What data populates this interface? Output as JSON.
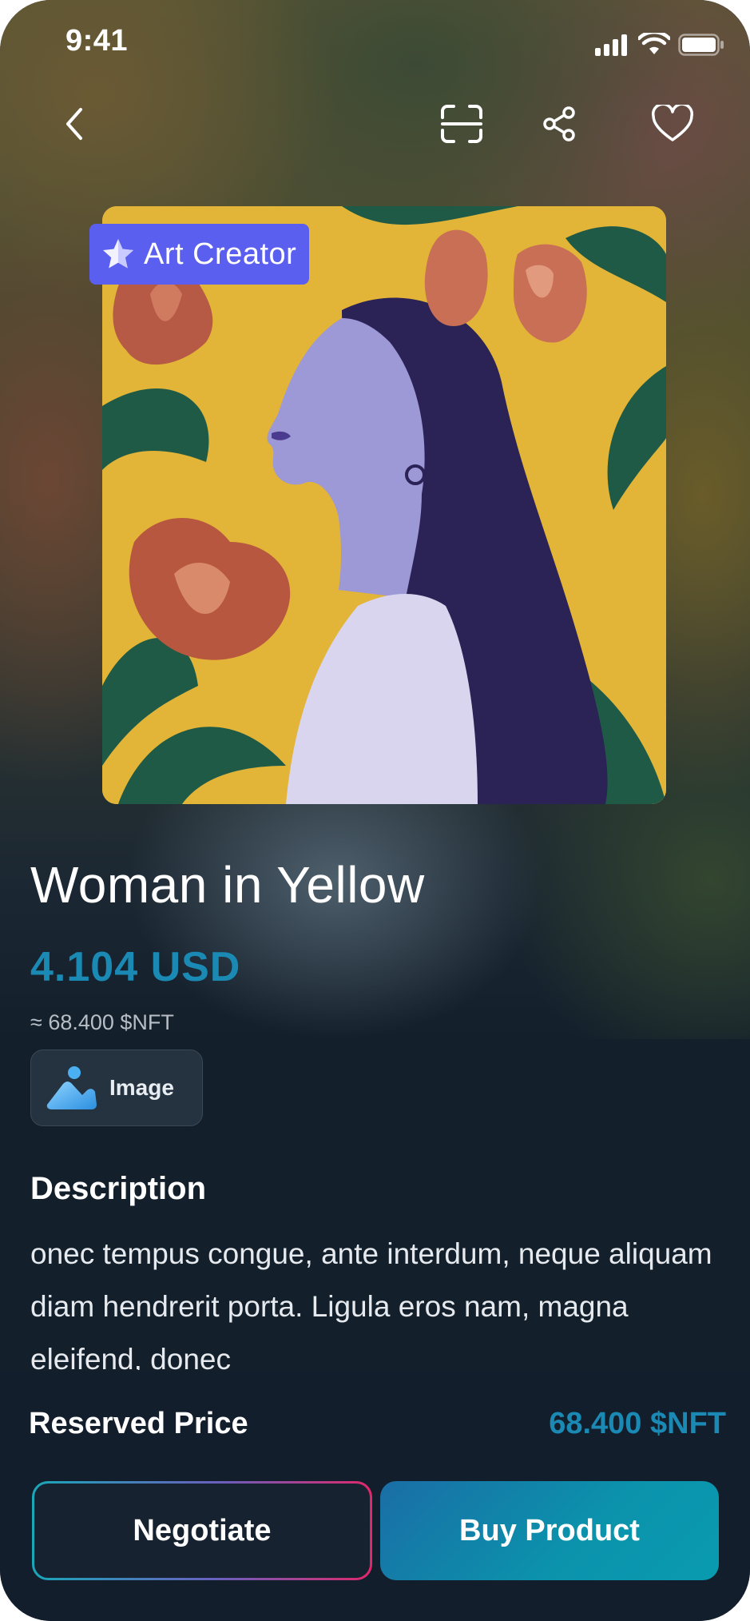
{
  "status_bar": {
    "time": "9:41"
  },
  "header": {
    "icons": [
      "back-chevron-icon",
      "scan-icon",
      "share-icon",
      "heart-icon"
    ]
  },
  "badge": {
    "label": "Art Creator",
    "icon": "star-icon",
    "color": "#5b5ff0"
  },
  "product": {
    "title": "Woman in Yellow",
    "price": "4.104 USD",
    "price_nft": "≈ 68.400 $NFT",
    "type_label": "Image",
    "type_icon": "image-icon"
  },
  "description": {
    "heading": "Description",
    "text": "onec tempus congue, ante interdum, neque aliquam diam hendrerit porta. Ligula eros nam, magna eleifend, donec"
  },
  "footer": {
    "reserved_label": "Reserved Price",
    "reserved_value": "68.400 $NFT",
    "negotiate_label": "Negotiate",
    "buy_label": "Buy Product"
  },
  "colors": {
    "accent_price": "#1a8ab4",
    "background": "#131f2b",
    "badge": "#5b5ff0",
    "negotiate_border_gradient": [
      "#1aa7b8",
      "#e0286b"
    ],
    "buy_gradient": [
      "#1a6ea6",
      "#0a9bb0"
    ]
  }
}
